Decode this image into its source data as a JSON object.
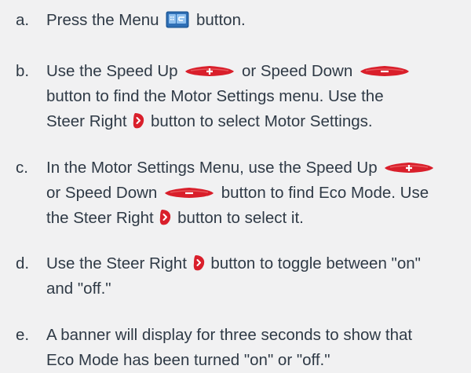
{
  "steps": [
    {
      "marker": "a.",
      "line1_before": "Press the Menu",
      "line1_after": "button."
    },
    {
      "marker": "b.",
      "line1_before": "Use the Speed Up",
      "line1_mid": "or Speed Down",
      "line2": "button to find the Motor Settings menu. Use the",
      "line3_before": "Steer Right",
      "line3_after": "button to select Motor Settings."
    },
    {
      "marker": "c.",
      "line1_before": "In the Motor Settings Menu, use the Speed Up",
      "line2_before": "or Speed Down",
      "line2_after": "button to find Eco Mode. Use",
      "line3_before": "the Steer Right",
      "line3_after": "button to select it."
    },
    {
      "marker": "d.",
      "line1_before": "Use the Steer Right",
      "line1_after": "button to toggle between \"on\"",
      "line2": "and \"off.\""
    },
    {
      "marker": "e.",
      "line1": "A banner will display for three seconds to show that",
      "line2": "Eco Mode has been turned \"on\" or \"off.\""
    }
  ],
  "icons": {
    "menu": "menu-button-icon",
    "speed_up": "speed-up-button-icon",
    "speed_down": "speed-down-button-icon",
    "steer_right": "steer-right-button-icon"
  },
  "colors": {
    "background": "#f1f1f2",
    "text": "#2f3a46",
    "button_red": "#d91f2b",
    "menu_blue": "#2e6fb6"
  }
}
